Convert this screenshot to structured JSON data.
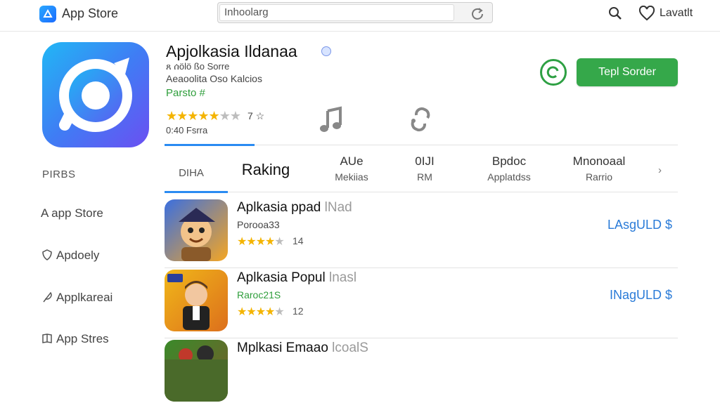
{
  "header": {
    "brand": "App Store",
    "search_value": "Inhoolarg",
    "account_label": "Lavatlt"
  },
  "app": {
    "title": "Apjolkasia Ildanaa",
    "sub1": "ጸ ሰölö ßo Sorre",
    "sub2": "Aeaoolita Oso Kalcios",
    "price": "Parsto #",
    "stars_filled": 5,
    "stars_total": 7,
    "rating": "7 ☆",
    "rating_count": "0:40 Fsrra",
    "get_label": "Tepl Sorder"
  },
  "tabs": [
    {
      "line1": "DIHA",
      "line2": ""
    },
    {
      "line1": "Raking",
      "line2": ""
    },
    {
      "line1": "AUe",
      "line2": "Mekiias"
    },
    {
      "line1": "0IJI",
      "line2": "RM"
    },
    {
      "line1": "Bpdoc",
      "line2": "Applatdss"
    },
    {
      "line1": "Mnonoaal",
      "line2": "Rarrio"
    }
  ],
  "sidebar": {
    "heading": "PIRBS",
    "items": [
      {
        "label": "A app Store"
      },
      {
        "label": "Apdoely"
      },
      {
        "label": "Applkareai"
      },
      {
        "label": "App Stres"
      }
    ]
  },
  "list": [
    {
      "title": "Aplkasia ppad",
      "ghost": " lNad",
      "sub": "Porooa33",
      "stars": 4,
      "count": "14",
      "price": "LAsgULD $"
    },
    {
      "title": "Aplkasia Popul",
      "ghost": " lnasl",
      "sub": "Raroc21S",
      "stars": 4,
      "count": "12",
      "price": "INagULD $"
    },
    {
      "title": "Mplkasi Emaao",
      "ghost": " lcoalS",
      "sub": "",
      "stars": 0,
      "count": "",
      "price": ""
    }
  ],
  "colors": {
    "accent_green": "#35a84a",
    "accent_blue": "#2a8bf2",
    "price_blue": "#2a7bd8",
    "star": "#f4b400"
  },
  "icons": [
    "app-store-logo-icon",
    "refresh-icon",
    "search-icon",
    "heart-icon",
    "verified-badge-icon",
    "music-note-icon",
    "link-icon",
    "check-circle-icon",
    "chevron-right-icon",
    "app-store-icon",
    "shield-icon",
    "feather-icon",
    "book-icon"
  ]
}
